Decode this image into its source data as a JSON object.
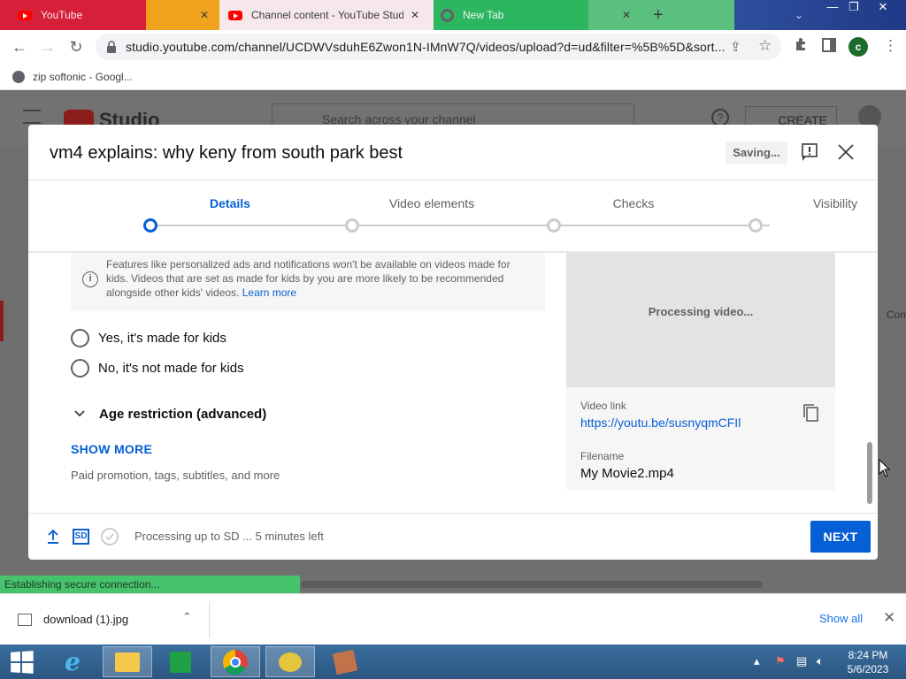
{
  "browser": {
    "tabs": [
      {
        "label": "YouTube"
      },
      {
        "label": "Channel content - YouTube Studio"
      },
      {
        "label": "New Tab"
      }
    ],
    "url": "studio.youtube.com/channel/UCDWVsduhE6Zwon1N-IMnW7Q/videos/upload?d=ud&filter=%5B%5D&sort...",
    "profile_initial": "c",
    "bookmark": "zip softonic - Googl..."
  },
  "studio": {
    "logo_text": "Studio",
    "search_placeholder": "Search across your channel",
    "create_label": "CREATE",
    "side_text": "Com"
  },
  "modal": {
    "title": "vm4 explains: why keny from south park best",
    "saving_label": "Saving...",
    "steps": [
      {
        "label": "Details",
        "active": true
      },
      {
        "label": "Video elements",
        "active": false
      },
      {
        "label": "Checks",
        "active": false
      },
      {
        "label": "Visibility",
        "active": false
      }
    ],
    "kids_info": "Features like personalized ads and notifications won't be available on videos made for kids. Videos that are set as made for kids by you are more likely to be recommended alongside other kids' videos.",
    "learn_more": "Learn more",
    "radio_yes": "Yes, it's made for kids",
    "radio_no": "No, it's not made for kids",
    "age_restriction": "Age restriction (advanced)",
    "show_more": "SHOW MORE",
    "show_more_sub": "Paid promotion, tags, subtitles, and more",
    "preview_status": "Processing video...",
    "video_link_label": "Video link",
    "video_link": "https://youtu.be/susnyqmCFIl",
    "filename_label": "Filename",
    "filename": "My Movie2.mp4",
    "footer_status": "Processing up to SD ... 5 minutes left",
    "sd_badge": "SD",
    "next_label": "NEXT"
  },
  "status_bar": "Establishing secure connection...",
  "downloads": {
    "file": "download (1).jpg",
    "show_all": "Show all"
  },
  "taskbar": {
    "time": "8:24 PM",
    "date": "5/6/2023"
  },
  "colors": {
    "accent": "#065fd4",
    "youtube_red": "#ff0000",
    "status_green": "#46c36b"
  }
}
